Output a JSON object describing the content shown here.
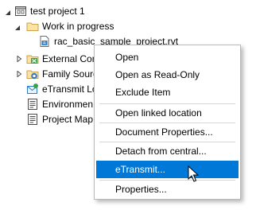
{
  "tree": {
    "root_label": "test project 1",
    "work_in_progress_label": "Work in progress",
    "file_label": "rac_basic_sample_project.rvt",
    "items": [
      {
        "label": "External Con"
      },
      {
        "label": "Family Sourc"
      },
      {
        "label": "eTransmit Lo"
      },
      {
        "label": "Environmen"
      },
      {
        "label": "Project Map"
      }
    ]
  },
  "context_menu": {
    "open": "Open",
    "open_read_only": "Open as Read-Only",
    "exclude_item": "Exclude Item",
    "open_linked_location": "Open linked location",
    "document_properties": "Document Properties...",
    "detach_from_central": "Detach from central...",
    "etransmit": "eTransmit...",
    "properties": "Properties..."
  },
  "colors": {
    "highlight": "#0078d7",
    "folder": "#e8b64a",
    "green": "#3aa04a"
  }
}
